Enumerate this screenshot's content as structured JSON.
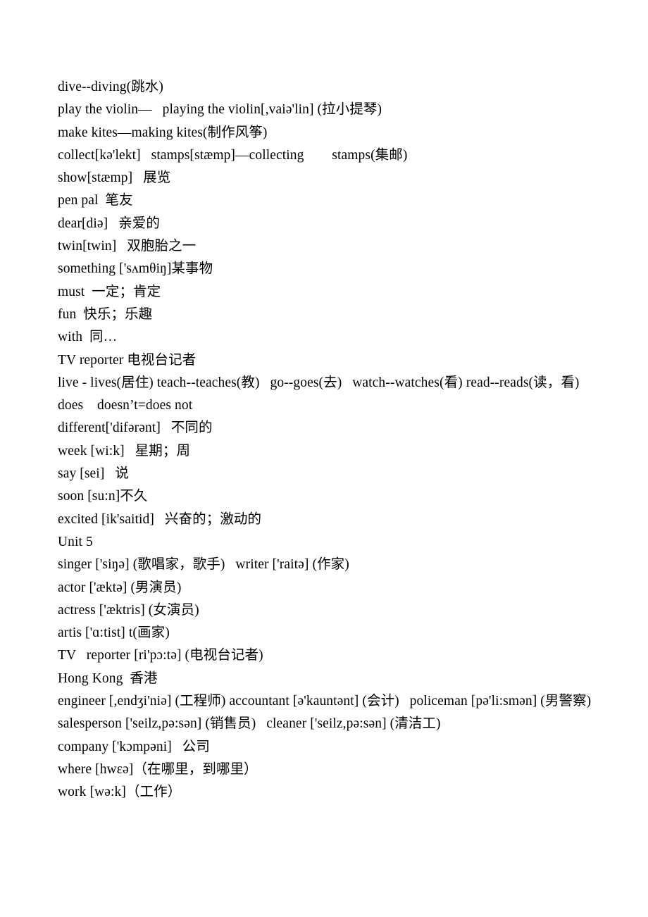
{
  "document": {
    "lines": [
      {
        "text": "dive--diving(跳水)"
      },
      {
        "text": "play the violin—   playing the violin[,vaiə'lin] (拉小提琴)"
      },
      {
        "text": "make kites—making kites(制作风筝)"
      },
      {
        "text": "collect[kə'lekt]   stamps[stæmp]—collecting        stamps(集邮)"
      },
      {
        "text": "show[stæmp]   展览"
      },
      {
        "text": "pen pal  笔友"
      },
      {
        "text": "dear[diə]   亲爱的"
      },
      {
        "text": "twin[twin]   双胞胎之一"
      },
      {
        "text": "something ['sʌmθiŋ]某事物"
      },
      {
        "text": "must  一定；肯定"
      },
      {
        "text": "fun  快乐；乐趣"
      },
      {
        "text": "with  同…"
      },
      {
        "text": "TV reporter 电视台记者"
      },
      {
        "text": "live ‐ lives(居住) teach--teaches(教)   go--goes(去)   watch--watches(看) read--reads(读，看)"
      },
      {
        "text": "does    doesn’t=does not"
      },
      {
        "text": "different['difərənt]   不同的"
      },
      {
        "text": "week [wi:k]   星期；周"
      },
      {
        "text": "say [sei]   说"
      },
      {
        "text": "soon [su:n]不久"
      },
      {
        "text": "excited [ik'saitid]   兴奋的；激动的"
      },
      {
        "text": "Unit 5"
      },
      {
        "text": "singer ['siŋə] (歌唱家，歌手)   writer ['raitə] (作家)"
      },
      {
        "text": "actor ['æktə] (男演员)"
      },
      {
        "text": "actress ['æktris] (女演员)"
      },
      {
        "text": "artis ['ɑ:tist] t(画家)"
      },
      {
        "text": "TV   reporter [ri'pɔ:tə] (电视台记者)"
      },
      {
        "text": "Hong Kong  香港"
      },
      {
        "text": "engineer [,endʒi'niə] (工程师) accountant [ə'kauntənt] (会计)   policeman [pə'li:smən] (男警察)   salesperson ['seilz,pə:sən] (销售员)   cleaner ['seilz,pə:sən] (清洁工)"
      },
      {
        "text": "company ['kɔmpəni]   公司"
      },
      {
        "text": "where [hwɛə]（在哪里，到哪里）"
      },
      {
        "text": "work [wə:k]（工作）"
      }
    ]
  }
}
